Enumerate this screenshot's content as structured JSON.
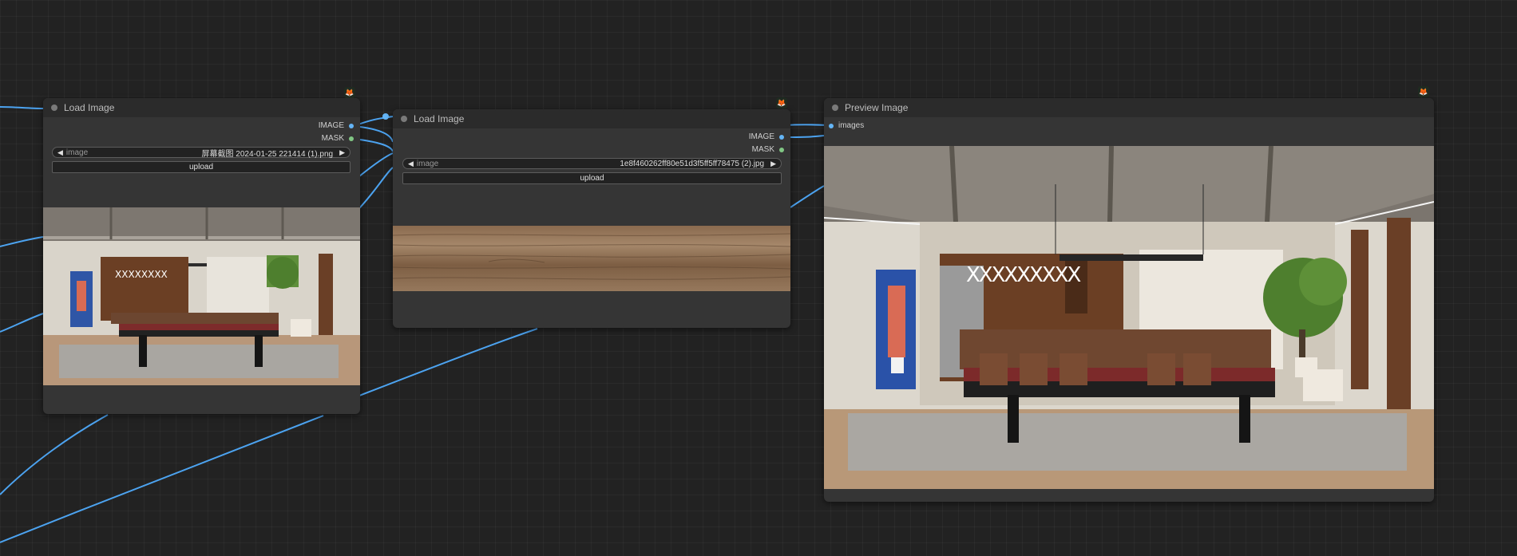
{
  "nodes": {
    "load_image_1": {
      "title": "Load Image",
      "outputs": {
        "image": "IMAGE",
        "mask": "MASK"
      },
      "widget": {
        "name": "image",
        "value": "屏幕截图 2024-01-25 221414 (1).png"
      },
      "upload_label": "upload",
      "badge_icon": "fox-icon",
      "preview": "room-with-pool-table-thumbnail"
    },
    "load_image_2": {
      "title": "Load Image",
      "outputs": {
        "image": "IMAGE",
        "mask": "MASK"
      },
      "widget": {
        "name": "image",
        "value": "1e8f460262ff80e51d3f5ff5ff78475 (2).jpg"
      },
      "upload_label": "upload",
      "badge_icon": "fox-icon",
      "preview": "wood-texture-thumbnail"
    },
    "preview_image": {
      "title": "Preview Image",
      "inputs": {
        "images": "images"
      },
      "badge_icon": "fox-icon",
      "preview": "room-with-pool-table-render"
    }
  },
  "colors": {
    "canvas": "#222222",
    "node_body": "#353535",
    "node_header": "#2b2b2b",
    "link_image": "#4ca3f0",
    "slot_image": "#64b5f6",
    "slot_mask": "#81c784"
  }
}
